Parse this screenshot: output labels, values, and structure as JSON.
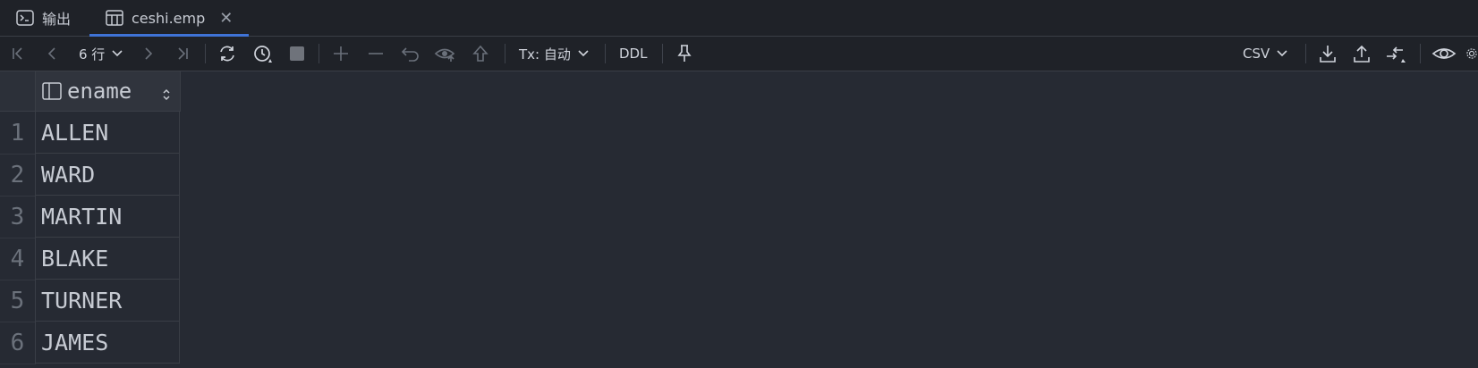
{
  "tabs": [
    {
      "label": "输出",
      "icon": "terminal-icon",
      "active": false
    },
    {
      "label": "ceshi.emp",
      "icon": "table-icon",
      "active": true
    }
  ],
  "toolbar": {
    "row_count": "6 行",
    "tx_label": "Tx: 自动",
    "ddl_label": "DDL",
    "export_format": "CSV"
  },
  "table": {
    "columns": [
      "ename"
    ],
    "rows": [
      {
        "num": "1",
        "ename": "ALLEN"
      },
      {
        "num": "2",
        "ename": "WARD"
      },
      {
        "num": "3",
        "ename": "MARTIN"
      },
      {
        "num": "4",
        "ename": "BLAKE"
      },
      {
        "num": "5",
        "ename": "TURNER"
      },
      {
        "num": "6",
        "ename": "JAMES"
      }
    ]
  },
  "colors": {
    "background": "#262a33",
    "bar": "#1f2228",
    "accent": "#3f73d6"
  }
}
